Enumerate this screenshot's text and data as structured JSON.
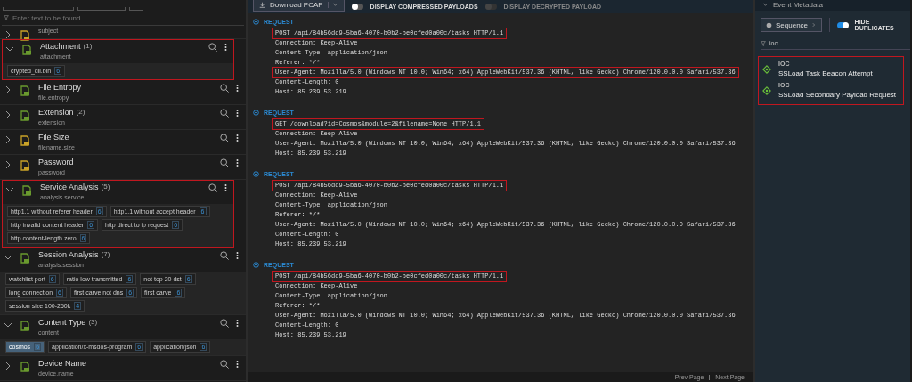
{
  "left": {
    "filter_placeholder": "Enter text to be found.",
    "fields": [
      {
        "key": "subject",
        "expanded": false,
        "highlighted": false,
        "color": "#c9a227"
      },
      {
        "title": "Attachment",
        "count": "(1)",
        "key": "attachment",
        "expanded": true,
        "highlighted": true,
        "color": "#6a9a2e",
        "tags": [
          {
            "label": "crypted_dll.bin",
            "count": "6",
            "selected": false
          }
        ]
      },
      {
        "title": "File Entropy",
        "key": "file.entropy",
        "expanded": false,
        "highlighted": false,
        "color": "#6a9a2e"
      },
      {
        "title": "Extension",
        "count": "(2)",
        "key": "extension",
        "expanded": false,
        "highlighted": false,
        "color": "#6a9a2e"
      },
      {
        "title": "File Size",
        "key": "filename.size",
        "expanded": false,
        "highlighted": false,
        "color": "#c9a227"
      },
      {
        "title": "Password",
        "key": "password",
        "expanded": false,
        "highlighted": false,
        "color": "#c9a227"
      },
      {
        "title": "Service Analysis",
        "count": "(5)",
        "key": "analysis.service",
        "expanded": true,
        "highlighted": true,
        "color": "#6a9a2e",
        "tags": [
          {
            "label": "http1.1 without referer header",
            "count": "6",
            "selected": false
          },
          {
            "label": "http1.1 without accept header",
            "count": "6",
            "selected": false
          },
          {
            "label": "http invalid content header",
            "count": "6",
            "selected": false
          },
          {
            "label": "http direct to ip request",
            "count": "6",
            "selected": false
          },
          {
            "label": "http content-length zero",
            "count": "6",
            "selected": false
          }
        ]
      },
      {
        "title": "Session Analysis",
        "count": "(7)",
        "key": "analysis.session",
        "expanded": true,
        "highlighted": false,
        "color": "#6a9a2e",
        "tags": [
          {
            "label": "watchlist port",
            "count": "6",
            "selected": false
          },
          {
            "label": "ratio low transmitted",
            "count": "6",
            "selected": false
          },
          {
            "label": "not top 20 dst",
            "count": "6",
            "selected": false
          },
          {
            "label": "long connection",
            "count": "6",
            "selected": false
          },
          {
            "label": "first carve not dns",
            "count": "6",
            "selected": false
          },
          {
            "label": "first carve",
            "count": "6",
            "selected": false
          },
          {
            "label": "session size 100-250k",
            "count": "4",
            "selected": false
          }
        ]
      },
      {
        "title": "Content Type",
        "count": "(3)",
        "key": "content",
        "expanded": true,
        "highlighted": false,
        "color": "#6a9a2e",
        "tags": [
          {
            "label": "cosmos",
            "count": "6",
            "selected": true
          },
          {
            "label": "application/x-msdos-program",
            "count": "6",
            "selected": false
          },
          {
            "label": "application/json",
            "count": "6",
            "selected": false
          }
        ]
      },
      {
        "title": "Device Name",
        "key": "device.name",
        "expanded": false,
        "highlighted": false,
        "color": "#6a9a2e"
      }
    ]
  },
  "middle": {
    "download_button": "Download PCAP",
    "compressed": {
      "label": "DISPLAY COMPRESSED PAYLOADS",
      "on": false
    },
    "decrypted": {
      "label": "DISPLAY DECRYPTED PAYLOAD",
      "on": false,
      "disabled": true
    },
    "requests": [
      {
        "label": "REQUEST",
        "lines": [
          {
            "text": "POST /api/84b56dd9-5ba6-4070-b0b2-be0cfed0a00c/tasks HTTP/1.1",
            "highlighted": true
          },
          {
            "text": "Connection: Keep-Alive",
            "highlighted": false
          },
          {
            "text": "Content-Type: application/json",
            "highlighted": false
          },
          {
            "text": "Referer: */*",
            "highlighted": false
          },
          {
            "text": "User-Agent: Mozilla/5.0 (Windows NT 10.0; Win64; x64) AppleWebKit/537.36 (KHTML, like Gecko) Chrome/120.0.0.0 Safari/537.36",
            "highlighted": true
          },
          {
            "text": "Content-Length: 0",
            "highlighted": false
          },
          {
            "text": "Host: 85.239.53.219",
            "highlighted": false
          }
        ]
      },
      {
        "label": "REQUEST",
        "lines": [
          {
            "text": "GET /download?id=Cosmos&module=2&filename=None HTTP/1.1",
            "highlighted": true
          },
          {
            "text": "Connection: Keep-Alive",
            "highlighted": false
          },
          {
            "text": "User-Agent: Mozilla/5.0 (Windows NT 10.0; Win64; x64) AppleWebKit/537.36 (KHTML, like Gecko) Chrome/120.0.0.0 Safari/537.36",
            "highlighted": false
          },
          {
            "text": "Host: 85.239.53.219",
            "highlighted": false
          }
        ]
      },
      {
        "label": "REQUEST",
        "lines": [
          {
            "text": "POST /api/84b56dd9-5ba6-4070-b0b2-be0cfed0a00c/tasks HTTP/1.1",
            "highlighted": true
          },
          {
            "text": "Connection: Keep-Alive",
            "highlighted": false
          },
          {
            "text": "Content-Type: application/json",
            "highlighted": false
          },
          {
            "text": "Referer: */*",
            "highlighted": false
          },
          {
            "text": "User-Agent: Mozilla/5.0 (Windows NT 10.0; Win64; x64) AppleWebKit/537.36 (KHTML, like Gecko) Chrome/120.0.0.0 Safari/537.36",
            "highlighted": false
          },
          {
            "text": "Content-Length: 0",
            "highlighted": false
          },
          {
            "text": "Host: 85.239.53.219",
            "highlighted": false
          }
        ]
      },
      {
        "label": "REQUEST",
        "lines": [
          {
            "text": "POST /api/84b56dd9-5ba6-4070-b0b2-be0cfed0a00c/tasks HTTP/1.1",
            "highlighted": true
          },
          {
            "text": "Connection: Keep-Alive",
            "highlighted": false
          },
          {
            "text": "Content-Type: application/json",
            "highlighted": false
          },
          {
            "text": "Referer: */*",
            "highlighted": false
          },
          {
            "text": "User-Agent: Mozilla/5.0 (Windows NT 10.0; Win64; x64) AppleWebKit/537.36 (KHTML, like Gecko) Chrome/120.0.0.0 Safari/537.36",
            "highlighted": false
          },
          {
            "text": "Content-Length: 0",
            "highlighted": false
          },
          {
            "text": "Host: 85.239.53.219",
            "highlighted": false
          }
        ]
      }
    ],
    "footer": {
      "prev": "Prev Page",
      "next": "Next Page"
    }
  },
  "right": {
    "title": "Event Metadata",
    "sequence_button": "Sequence",
    "hide_duplicates": {
      "label": "HIDE DUPLICATES",
      "on": true
    },
    "filter_value": "ioc",
    "results": {
      "highlighted": true,
      "items": [
        {
          "type": "IOC",
          "title": "SSLoad Task Beacon Attempt"
        },
        {
          "type": "IOC",
          "title": "SSLoad Secondary Payload Request"
        }
      ]
    }
  }
}
